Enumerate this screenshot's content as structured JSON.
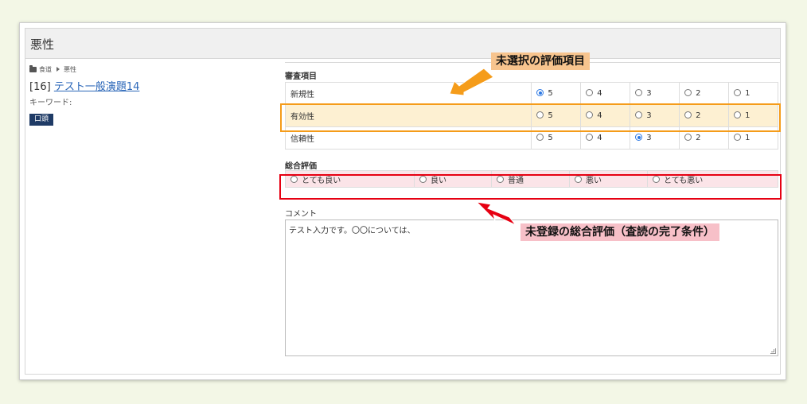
{
  "panel": {
    "title": "悪性"
  },
  "breadcrumb": {
    "items": [
      "食道",
      "悪性"
    ]
  },
  "item": {
    "number": "[16]",
    "title": "テスト一般演題14",
    "keyword_label": "キーワード:",
    "tag": "口頭"
  },
  "review": {
    "section_title": "審査項目",
    "rows": [
      {
        "name": "新規性",
        "selected": "5"
      },
      {
        "name": "有効性",
        "selected": null
      },
      {
        "name": "信頼性",
        "selected": "3"
      }
    ],
    "scale": [
      "5",
      "4",
      "3",
      "2",
      "1"
    ]
  },
  "overall": {
    "section_title": "総合評価",
    "options": [
      "とても良い",
      "良い",
      "普通",
      "悪い",
      "とても悪い"
    ],
    "selected": null
  },
  "comment": {
    "label": "コメント",
    "value": "テスト入力です。〇〇については、"
  },
  "annotations": {
    "unselected_item": "未選択の評価項目",
    "unregistered_overall": "未登録の総合評価（査読の完了条件）",
    "orange": "#f59c1a",
    "red": "#e60012",
    "orange_label_bg": "#f7c48e",
    "red_label_bg": "#f7c0c8"
  }
}
